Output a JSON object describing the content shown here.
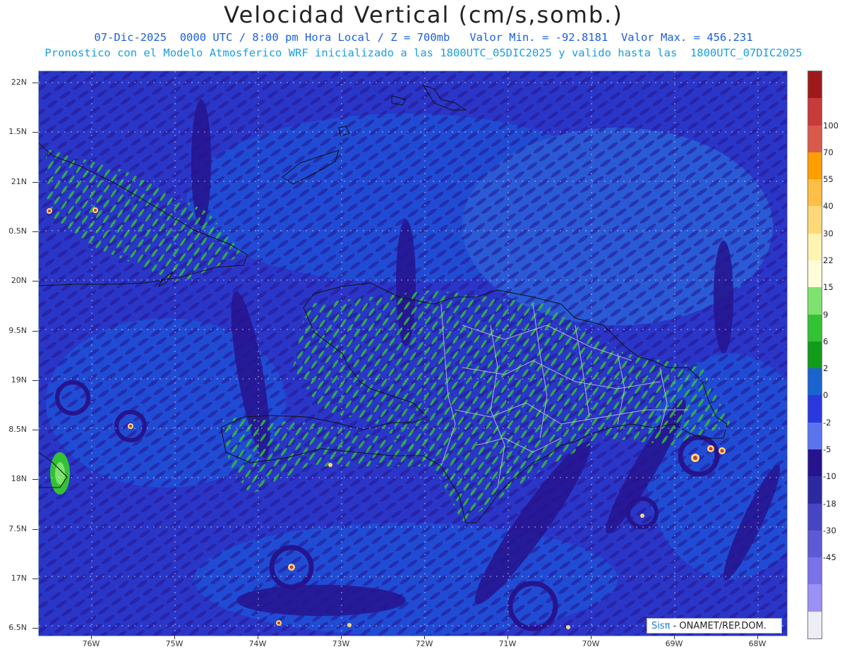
{
  "title": "Velocidad Vertical (cm/s,somb.)",
  "subtitle_line1": "07-Dic-2025  0000 UTC / 8:00 pm Hora Local / Z = 700mb   Valor Min. = -92.8181  Valor Max. = 456.231",
  "subtitle_line2": "Pronostico con el Modelo Atmosferico WRF inicializado a las 1800UTC_05DIC2025 y valido hasta las  1800UTC_07DIC2025",
  "lat_labels": [
    "22N",
    "1.5N",
    "21N",
    "0.5N",
    "20N",
    "9.5N",
    "19N",
    "8.5N",
    "18N",
    "7.5N",
    "17N",
    "6.5N"
  ],
  "lon_labels": [
    "76W",
    "75W",
    "74W",
    "73W",
    "72W",
    "71W",
    "70W",
    "69W",
    "68W"
  ],
  "colorbar": {
    "labels": [
      "100",
      "70",
      "55",
      "40",
      "30",
      "22",
      "15",
      "9",
      "6",
      "2",
      "0",
      "-2",
      "-5",
      "-10",
      "-18",
      "-30",
      "-45"
    ],
    "colors": [
      "#9e1a1a",
      "#c73b3b",
      "#d85a4a",
      "#ff9e00",
      "#ffbe45",
      "#ffd979",
      "#fff3b0",
      "#fffcd8",
      "#7ee26e",
      "#32c234",
      "#129c1a",
      "#1a64d0",
      "#2a38e0",
      "#5a74f0",
      "#26148e",
      "#2d2aa0",
      "#4646c2",
      "#5e5ad6",
      "#7a72e8",
      "#9a90f5",
      "#ededf5"
    ]
  },
  "credit": {
    "brand": "Sisπ",
    "rest": " - ONAMET/REP.DOM."
  },
  "palette": {
    "ocean_background": "#2a36c8",
    "weak_descent": "#1f4fd6",
    "weak_ascent": "#1a64d0",
    "strong_descent": "#26148e",
    "moderate_ascent": "#32c234",
    "strong_ascent": "#7ee26e",
    "extreme_core": "#c73b3b",
    "coastline": "#111111",
    "province_border": "#c8c8d8"
  }
}
